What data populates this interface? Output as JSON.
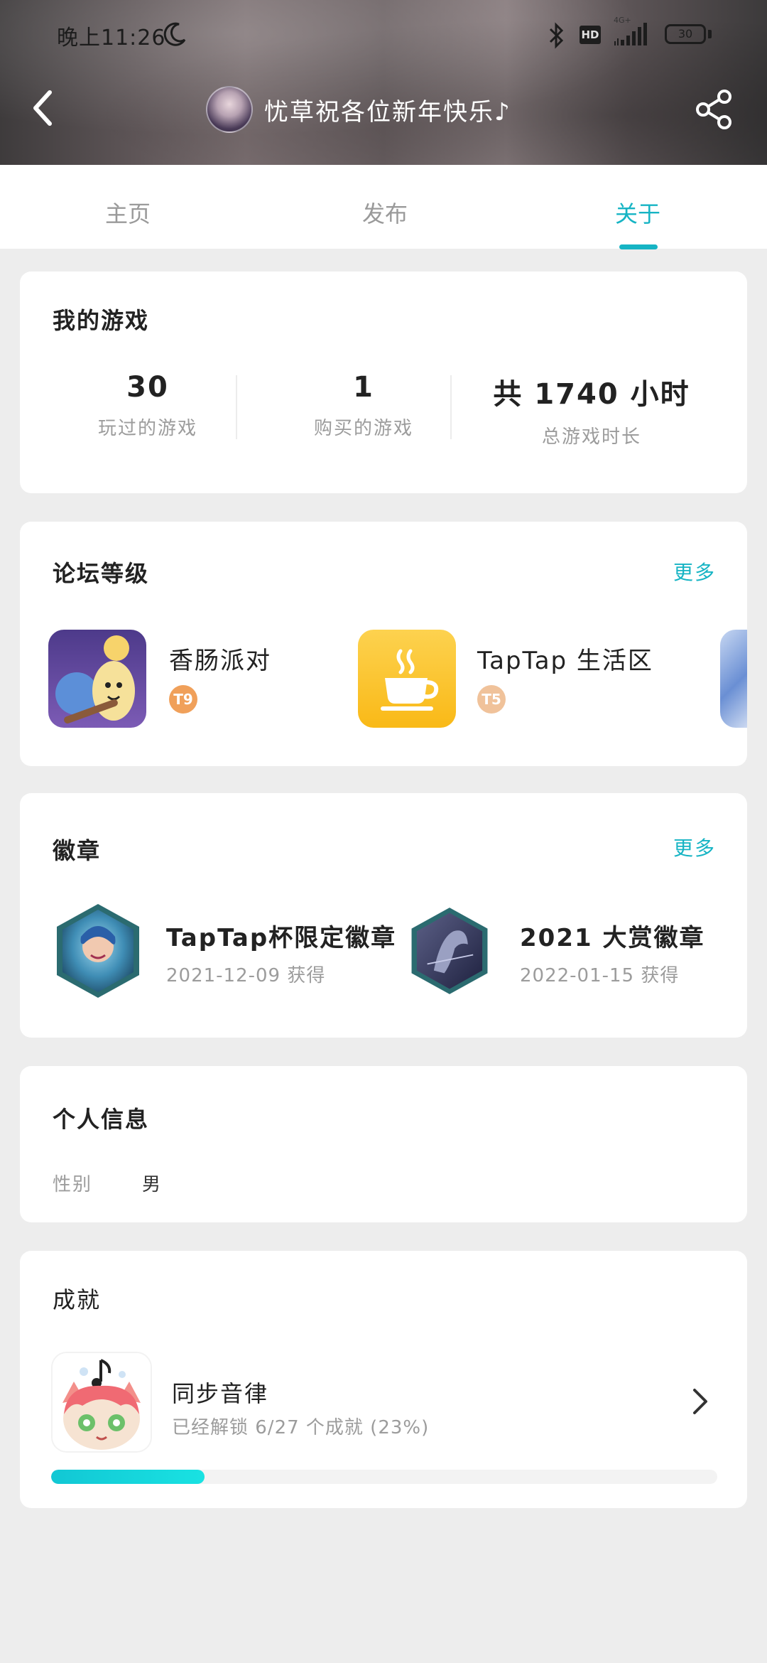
{
  "status_bar": {
    "time": "晚上11:26",
    "network_label": "4G+",
    "hd_label": "HD",
    "battery": "30"
  },
  "header": {
    "title": "忧草祝各位新年快乐♪"
  },
  "tabs": [
    {
      "label": "主页",
      "active": false
    },
    {
      "label": "发布",
      "active": false
    },
    {
      "label": "关于",
      "active": true
    }
  ],
  "my_games": {
    "title": "我的游戏",
    "stats": [
      {
        "value": "30",
        "label": "玩过的游戏"
      },
      {
        "value": "1",
        "label": "购买的游戏"
      },
      {
        "value": "共 1740 小时",
        "label": "总游戏时长"
      }
    ]
  },
  "forum_level": {
    "title": "论坛等级",
    "more": "更多",
    "items": [
      {
        "name": "香肠派对",
        "level": "T9",
        "level_color": "#f0a05a"
      },
      {
        "name": "TapTap 生活区",
        "level": "T5",
        "level_color": "#f0c29a"
      }
    ]
  },
  "badges": {
    "title": "徽章",
    "more": "更多",
    "items": [
      {
        "name": "TapTap杯限定徽章",
        "date": "2021-12-09 获得"
      },
      {
        "name": "2021 大赏徽章",
        "date": "2022-01-15 获得"
      }
    ]
  },
  "personal_info": {
    "title": "个人信息",
    "gender_label": "性别",
    "gender_value": "男"
  },
  "achievements": {
    "title": "成就",
    "item": {
      "name": "同步音律",
      "progress_text": "已经解锁 6/27 个成就 (23%)",
      "progress": 0.23
    }
  },
  "colors": {
    "accent": "#16b4c4",
    "background": "#ededed"
  },
  "icons": [
    "moon-icon",
    "bluetooth-icon",
    "signal-icon",
    "battery-icon",
    "back-arrow-icon",
    "share-icon",
    "coffee-cup-icon",
    "chevron-right-icon"
  ]
}
